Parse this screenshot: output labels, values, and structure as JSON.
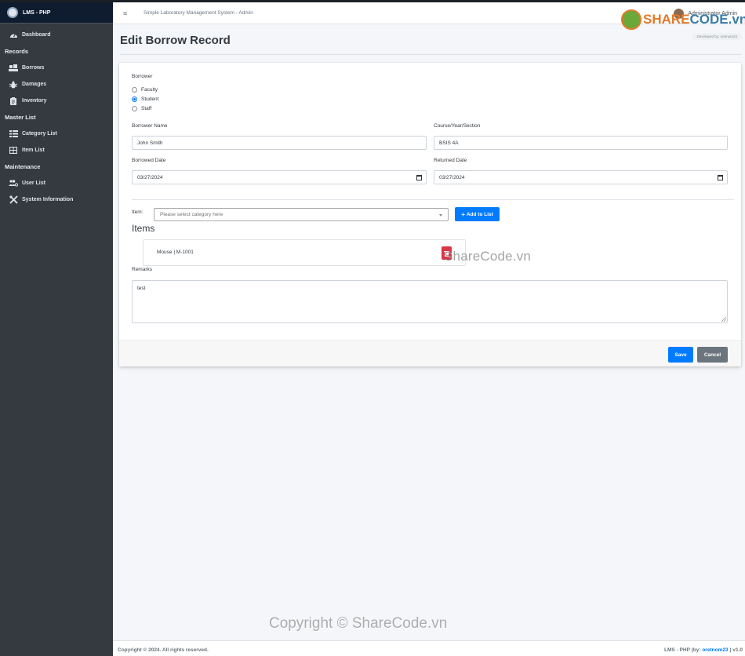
{
  "brand": {
    "name": "LMS - PHP"
  },
  "sidebar": {
    "dashboard": {
      "label": "Dashboard",
      "icon": "tachometer-icon"
    },
    "sections": [
      {
        "header": "Records",
        "items": [
          {
            "label": "Borrows",
            "icon": "dolly-icon"
          },
          {
            "label": "Damages",
            "icon": "bug-icon"
          },
          {
            "label": "Inventory",
            "icon": "clipboard-icon"
          }
        ]
      },
      {
        "header": "Master List",
        "items": [
          {
            "label": "Category List",
            "icon": "list-icon"
          },
          {
            "label": "Item List",
            "icon": "table-icon"
          }
        ]
      },
      {
        "header": "Maintenance",
        "items": [
          {
            "label": "User List",
            "icon": "users-cog-icon"
          },
          {
            "label": "System Information",
            "icon": "tools-icon"
          }
        ]
      }
    ]
  },
  "navbar": {
    "menu_icon": "≡",
    "system_title": "Simple Laboratory Management System - Admin",
    "user": "Administrator Admin"
  },
  "page": {
    "title": "Edit Borrow Record",
    "developer_tag": "Developed by: oretnom23"
  },
  "form": {
    "borrower_label": "Borrower",
    "borrower_options": [
      {
        "label": "Faculty",
        "checked": false
      },
      {
        "label": "Student",
        "checked": true
      },
      {
        "label": "Staff",
        "checked": false
      }
    ],
    "borrower_name_label": "Borrower Name",
    "borrower_name": "John Smith",
    "course_label": "Course/Year/Section",
    "course": "BSIS 4A",
    "borrowed_date_label": "Borrowed Date",
    "borrowed_date": "03/27/2024",
    "returned_date_label": "Returned Date",
    "returned_date": "03/27/2024",
    "item_label": "Item:",
    "item_placeholder": "Please select category here",
    "add_button": "Add to List",
    "items_heading": "Items",
    "items": [
      {
        "name": "Mouse | M-1001"
      }
    ],
    "remarks_label": "Remarks",
    "remarks": "test",
    "save_button": "Save",
    "cancel_button": "Cancel"
  },
  "footer": {
    "copyright": "Copyright © 2024. All rights reserved.",
    "credit_prefix": "LMS - PHP (by: ",
    "credit_author": "oretnom23",
    "credit_suffix": " ) v1.0"
  },
  "watermarks": {
    "logo_text_a": "SHARE",
    "logo_text_b": "CODE",
    "logo_text_c": ".vn",
    "middle": "ShareCode.vn",
    "bottom": "Copyright © ShareCode.vn"
  }
}
